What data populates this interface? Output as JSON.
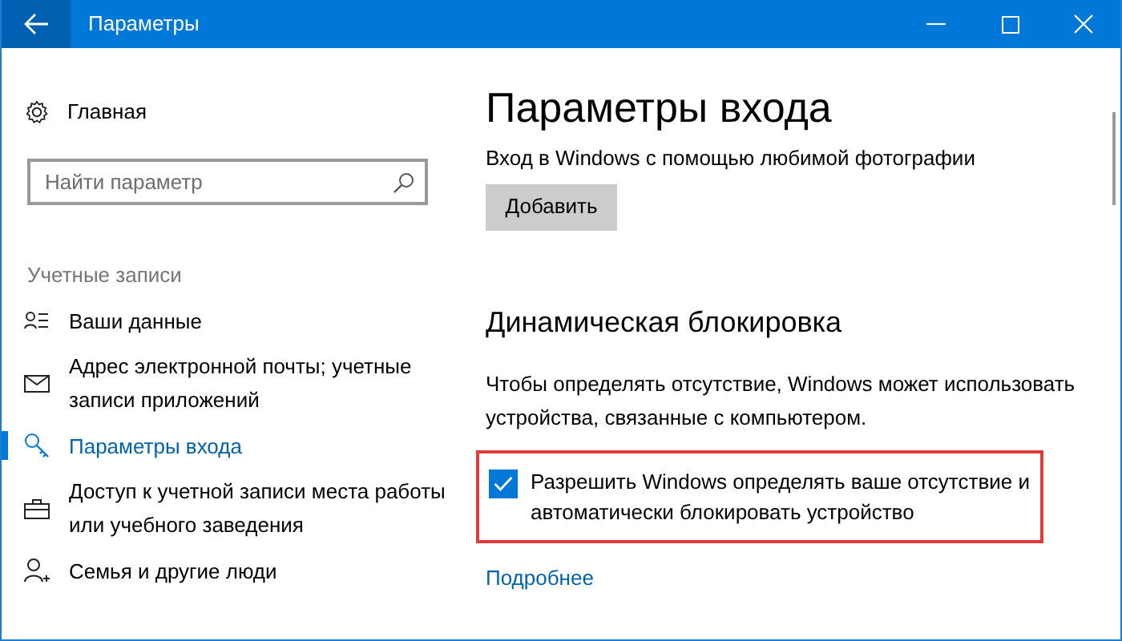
{
  "window": {
    "title": "Параметры"
  },
  "sidebar": {
    "home": {
      "label": "Главная"
    },
    "search": {
      "placeholder": "Найти параметр"
    },
    "section": "Учетные записи",
    "items": [
      {
        "label": "Ваши данные",
        "selected": false
      },
      {
        "label": "Адрес электронной почты; учетные записи приложений",
        "selected": false
      },
      {
        "label": "Параметры входа",
        "selected": true
      },
      {
        "label": "Доступ к учетной записи места работы или учебного заведения",
        "selected": false
      },
      {
        "label": "Семья и другие люди",
        "selected": false
      }
    ]
  },
  "content": {
    "title": "Параметры входа",
    "photo_text": "Вход в Windows с помощью любимой фотографии",
    "add_button": "Добавить",
    "dynamic_lock": {
      "heading": "Динамическая блокировка",
      "description": "Чтобы определять отсутствие, Windows может использовать устройства, связанные с компьютером.",
      "checkbox": {
        "label": "Разрешить Windows определять ваше отсутствие и автоматически блокировать устройство",
        "checked": true,
        "highlighted": true
      },
      "link": "Подробнее"
    }
  }
}
